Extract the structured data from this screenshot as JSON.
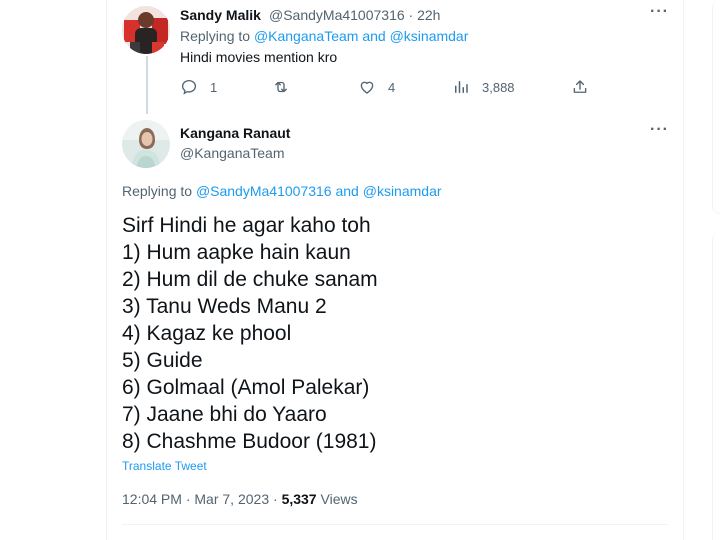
{
  "reply_tweet": {
    "author_name": "Sandy Malik",
    "author_handle": "@SandyMa41007316",
    "separator": "·",
    "time_ago": "22h",
    "replying_prefix": "Replying to",
    "replying_to_1": "@KanganaTeam",
    "replying_and": "and",
    "replying_to_2": "@ksinamdar",
    "text": "Hindi movies mention kro",
    "reply_count": "1",
    "retweet_count": "",
    "like_count": "4",
    "view_count": "3,888"
  },
  "main_tweet": {
    "author_name": "Kangana Ranaut",
    "author_handle": "@KanganaTeam",
    "replying_prefix": "Replying to",
    "replying_to_1": "@SandyMa41007316",
    "replying_and": "and",
    "replying_to_2": "@ksinamdar",
    "lines": [
      "Sirf Hindi he agar kaho toh",
      "1) Hum aapke hain kaun",
      "2) Hum dil de chuke sanam",
      "3) Tanu Weds Manu 2",
      "4) Kagaz ke phool",
      "5) Guide",
      "6) Golmaal (Amol Palekar)",
      "7) Jaane bhi do Yaaro",
      "8) Chashme Budoor (1981)"
    ],
    "translate_label": "Translate Tweet",
    "time": "12:04 PM",
    "date_separator": "·",
    "date": "Mar 7, 2023",
    "views_separator": "·",
    "views_count": "5,337",
    "views_label": "Views"
  },
  "icons": {
    "more": "more-icon",
    "reply": "reply-icon",
    "retweet": "retweet-icon",
    "like": "like-icon",
    "views": "views-icon",
    "share": "share-icon"
  },
  "colors": {
    "link": "#1d9bf0",
    "secondary_text": "#536471",
    "primary_text": "#0f1419",
    "border": "#eff3f4"
  }
}
